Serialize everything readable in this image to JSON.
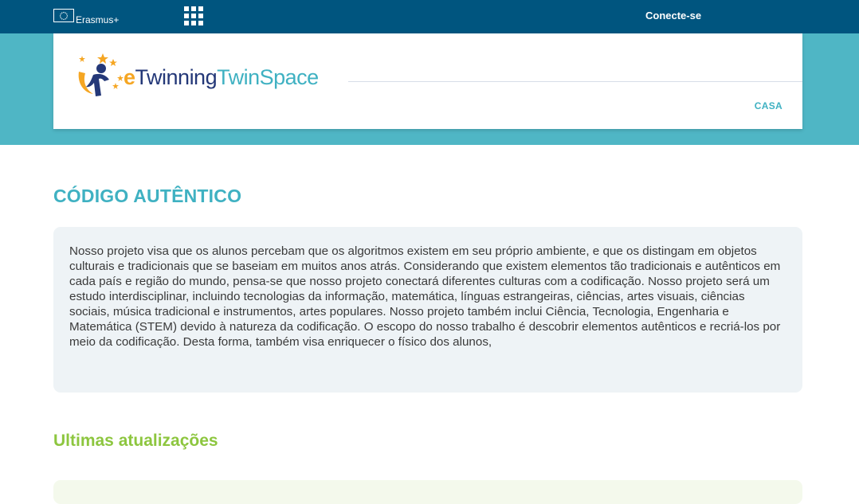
{
  "topbar": {
    "brand_label": "Erasmus+",
    "login_label": "Conecte-se",
    "apps_icon": "grid-apps-icon",
    "flag_icon": "eu-flag-icon"
  },
  "header": {
    "logo": {
      "letter_e": "e",
      "twinning": "Twinning",
      "twinspace": "TwinSpace"
    },
    "nav": {
      "home_label": "CASA"
    }
  },
  "main": {
    "title": "CÓDIGO AUTÊNTICO",
    "description": "Nosso projeto visa que os alunos percebam que os algoritmos existem em seu próprio ambiente, e que os distingam em objetos culturais e tradicionais que se baseiam em muitos anos atrás. Considerando que existem elementos tão tradicionais e autênticos em cada país e região do mundo, pensa-se que nosso projeto conectará diferentes culturas com a codificação. Nosso projeto será um estudo interdisciplinar, incluindo tecnologias da informação, matemática, línguas estrangeiras, ciências, artes visuais, ciências sociais, música tradicional e instrumentos, artes populares. Nosso projeto também inclui Ciência, Tecnologia, Engenharia e Matemática (STEM) devido à natureza da codificação. O escopo do nosso trabalho é descobrir elementos autênticos e recriá-los por meio da codificação. Desta forma, também visa enriquecer o físico dos alunos,",
    "updates_title": "Ultimas atualizações"
  },
  "colors": {
    "topbar": "#00557f",
    "teal": "#4fb6c5",
    "title": "#3fb1c2",
    "updates": "#8dc63f",
    "logo_orange": "#f5a623",
    "logo_navy": "#243878"
  }
}
